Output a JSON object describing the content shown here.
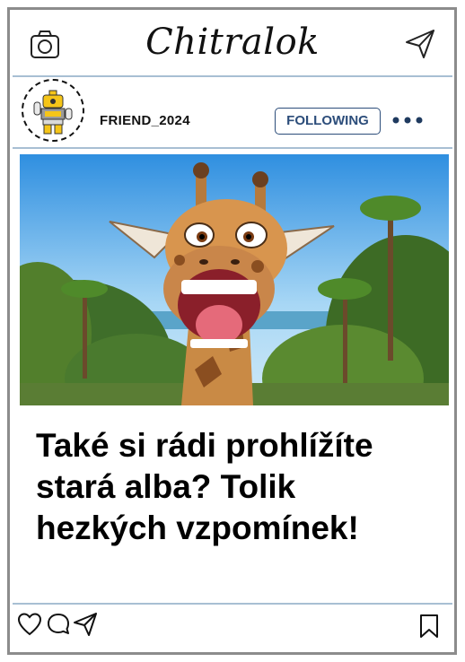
{
  "app": {
    "name": "Chitralok"
  },
  "post": {
    "username": "FRIEND_2024",
    "follow_label": "FOLLOWING",
    "caption": "Také si rádi prohlížíte stará alba? Tolik hezkých vzpomínek!",
    "image_description_icon": "laughing-giraffe-photo"
  },
  "icons": {
    "camera": "camera-icon",
    "send": "paper-plane-icon",
    "more": "more-dots-icon",
    "like": "heart-icon",
    "comment": "comment-bubble-icon",
    "share": "paper-plane-icon",
    "save": "bookmark-icon"
  },
  "colors": {
    "frame_border": "#8c8c8c",
    "divider": "#a8bfd3",
    "follow_accent": "#2c4d7a",
    "dots": "#1f3a5f"
  }
}
